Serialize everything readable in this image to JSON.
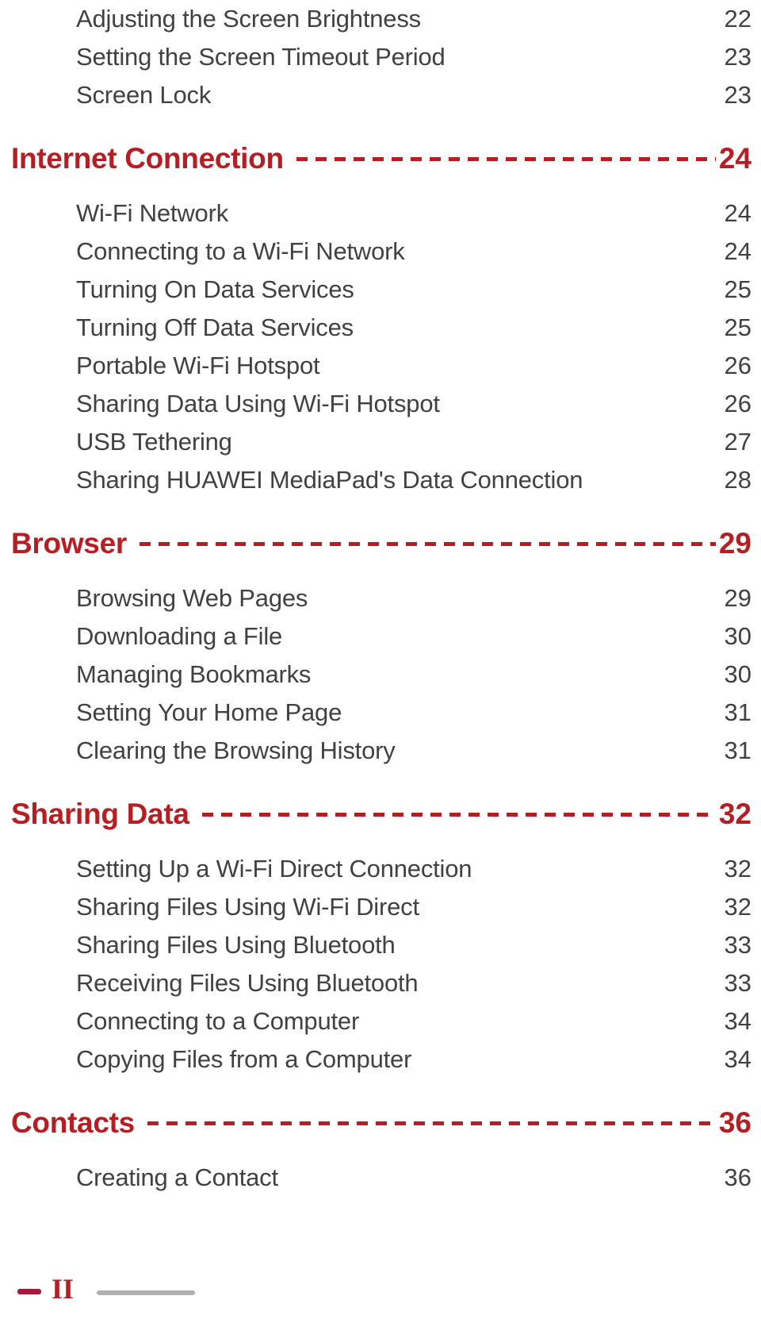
{
  "document": {
    "type": "table-of-contents",
    "accent_color": "#b51f23",
    "body_color": "#414141"
  },
  "toc": [
    {
      "kind": "entry",
      "label": "Adjusting the Screen Brightness",
      "page": "22"
    },
    {
      "kind": "entry",
      "label": "Setting the Screen Timeout Period",
      "page": "23"
    },
    {
      "kind": "entry",
      "label": "Screen Lock",
      "page": "23"
    },
    {
      "kind": "section",
      "label": "Internet Connection",
      "page": "24"
    },
    {
      "kind": "entry",
      "label": "Wi-Fi Network",
      "page": "24"
    },
    {
      "kind": "entry",
      "label": "Connecting to a Wi-Fi Network",
      "page": "24"
    },
    {
      "kind": "entry",
      "label": "Turning On Data Services",
      "page": "25"
    },
    {
      "kind": "entry",
      "label": "Turning Off Data Services",
      "page": "25"
    },
    {
      "kind": "entry",
      "label": "Portable Wi-Fi Hotspot",
      "page": "26"
    },
    {
      "kind": "entry",
      "label": "Sharing Data Using Wi-Fi Hotspot",
      "page": "26"
    },
    {
      "kind": "entry",
      "label": "USB Tethering",
      "page": "27"
    },
    {
      "kind": "entry",
      "label": "Sharing HUAWEI MediaPad's Data Connection",
      "page": "28"
    },
    {
      "kind": "section",
      "label": "Browser",
      "page": "29"
    },
    {
      "kind": "entry",
      "label": "Browsing Web Pages",
      "page": "29"
    },
    {
      "kind": "entry",
      "label": "Downloading a File",
      "page": "30"
    },
    {
      "kind": "entry",
      "label": "Managing Bookmarks",
      "page": "30"
    },
    {
      "kind": "entry",
      "label": "Setting Your Home Page",
      "page": "31"
    },
    {
      "kind": "entry",
      "label": "Clearing the Browsing History",
      "page": "31"
    },
    {
      "kind": "section",
      "label": "Sharing Data",
      "page": "32"
    },
    {
      "kind": "entry",
      "label": "Setting Up a Wi-Fi Direct Connection",
      "page": "32"
    },
    {
      "kind": "entry",
      "label": "Sharing Files Using Wi-Fi Direct",
      "page": "32"
    },
    {
      "kind": "entry",
      "label": "Sharing Files Using Bluetooth",
      "page": "33"
    },
    {
      "kind": "entry",
      "label": "Receiving Files Using Bluetooth",
      "page": "33"
    },
    {
      "kind": "entry",
      "label": "Connecting to a Computer",
      "page": "34"
    },
    {
      "kind": "entry",
      "label": "Copying Files from a Computer",
      "page": "34"
    },
    {
      "kind": "section",
      "label": "Contacts",
      "page": "36"
    },
    {
      "kind": "entry",
      "label": "Creating a Contact",
      "page": "36"
    }
  ],
  "footer": {
    "folio": "II"
  }
}
